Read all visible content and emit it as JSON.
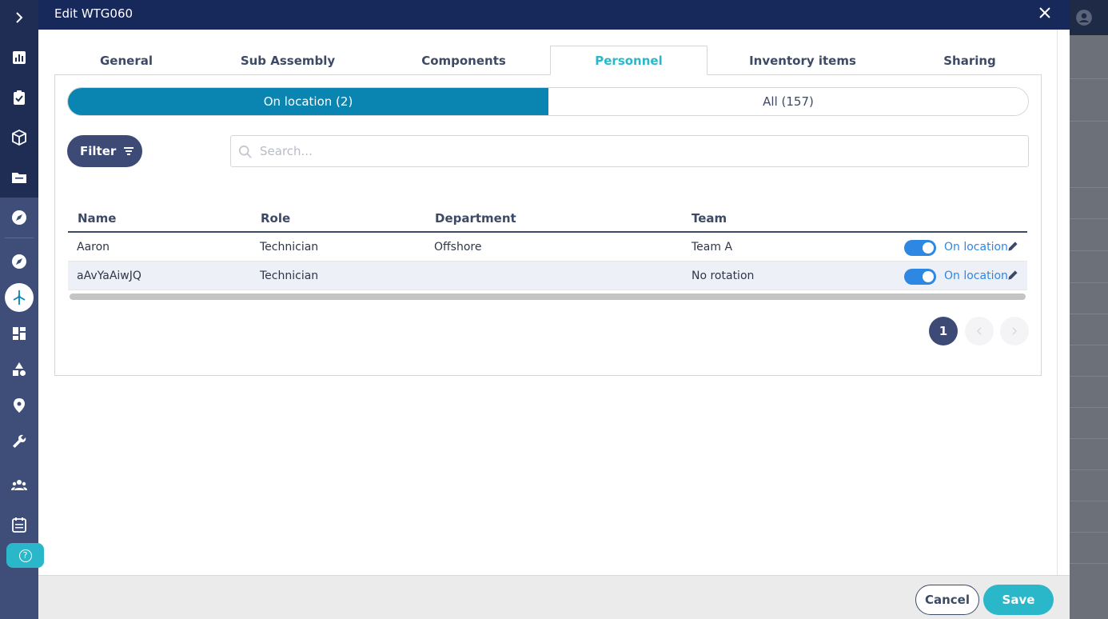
{
  "modal": {
    "title": "Edit WTG060",
    "close_icon": "close-icon"
  },
  "tabs": [
    {
      "label": "General"
    },
    {
      "label": "Sub Assembly"
    },
    {
      "label": "Components"
    },
    {
      "label": "Personnel",
      "active": true
    },
    {
      "label": "Inventory items"
    },
    {
      "label": "Sharing"
    }
  ],
  "segment": {
    "on_location": "On location (2)",
    "all": "All (157)"
  },
  "filter": {
    "label": "Filter"
  },
  "search": {
    "placeholder": "Search..."
  },
  "table": {
    "columns": [
      "Name",
      "Role",
      "Department",
      "Team"
    ],
    "rows": [
      {
        "name": "Aaron",
        "role": "Technician",
        "department": "Offshore",
        "team": "Team A",
        "status": "On location",
        "on": true
      },
      {
        "name": "aAvYaAiwJQ",
        "role": "Technician",
        "department": "",
        "team": "No rotation",
        "status": "On location",
        "on": true
      }
    ]
  },
  "pagination": {
    "current": "1"
  },
  "footer": {
    "cancel": "Cancel",
    "save": "Save"
  },
  "colors": {
    "header": "#17285a",
    "accent": "#2ab7c9",
    "segment_active": "#0a84b0",
    "toggle": "#2d88e3",
    "sidebar": "#3e4e79"
  }
}
